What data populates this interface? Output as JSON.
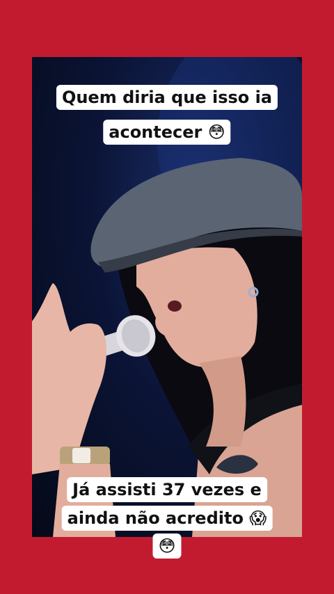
{
  "captions": {
    "top": [
      "Quem diria que isso ia",
      "acontecer 😳"
    ],
    "bottom": [
      "Já assisti 37 vezes e",
      "ainda não acredito 😱",
      "😳"
    ]
  },
  "colors": {
    "frame": "#c21b30",
    "caption_bg": "#ffffff",
    "caption_text": "#111111"
  }
}
